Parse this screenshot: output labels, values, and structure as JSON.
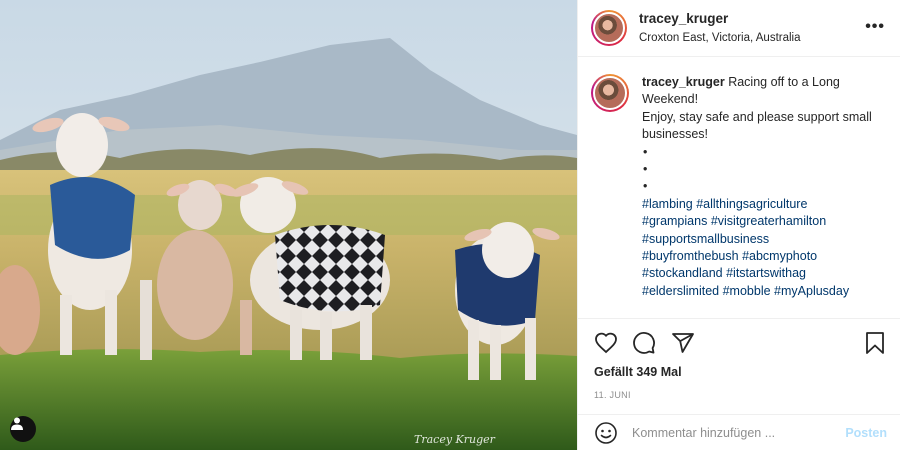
{
  "post": {
    "username": "tracey_kruger",
    "location": "Croxton East, Victoria, Australia",
    "caption": {
      "line1": "Racing off to a Long Weekend!",
      "line2": "Enjoy, stay safe and please support small businesses!",
      "bullets": [
        "•",
        "•",
        "•"
      ],
      "hashtags": [
        "#lambing",
        "#allthingsagriculture",
        "#grampians",
        "#visitgreaterhamilton",
        "#supportsmallbusiness",
        "#buyfromthebush",
        "#abcmyphoto",
        "#stockandland",
        "#itstartswithag",
        "#elderslimited",
        "#mobble",
        "#myAplusday"
      ]
    },
    "likes": "Gefällt 349 Mal",
    "date": "11. JUNI",
    "comment": {
      "placeholder": "Kommentar hinzufügen ...",
      "post_label": "Posten"
    },
    "photo": {
      "watermark": "Tracey Kruger",
      "icons": {
        "user_tag": "person-icon"
      }
    }
  },
  "colors": {
    "hashtag": "#00376b",
    "post_button": "#b2dffc",
    "muted": "#8e8e8e",
    "border": "#efefef"
  }
}
